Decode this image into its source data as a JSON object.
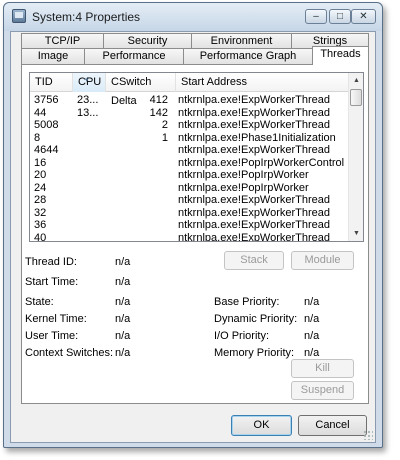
{
  "window": {
    "title": "System:4 Properties"
  },
  "title_buttons": {
    "minimize": "–",
    "maximize": "□",
    "close": "✕"
  },
  "tabs": {
    "row1": [
      "TCP/IP",
      "Security",
      "Environment",
      "Strings"
    ],
    "row2": [
      "Image",
      "Performance",
      "Performance Graph",
      "Threads"
    ],
    "active": "Threads"
  },
  "threads_list": {
    "columns": [
      "TID",
      "CPU",
      "CSwitch Delta",
      "Start Address"
    ],
    "sorted_column": "CPU",
    "rows": [
      [
        "3756",
        "23...",
        "412",
        "ntkrnlpa.exe!ExpWorkerThread"
      ],
      [
        "44",
        "13...",
        "142",
        "ntkrnlpa.exe!ExpWorkerThread"
      ],
      [
        "5008",
        "",
        "2",
        "ntkrnlpa.exe!ExpWorkerThread"
      ],
      [
        "8",
        "",
        "1",
        "ntkrnlpa.exe!Phase1Initialization"
      ],
      [
        "4644",
        "",
        "",
        "ntkrnlpa.exe!ExpWorkerThread"
      ],
      [
        "16",
        "",
        "",
        "ntkrnlpa.exe!PopIrpWorkerControl"
      ],
      [
        "20",
        "",
        "",
        "ntkrnlpa.exe!PopIrpWorker"
      ],
      [
        "24",
        "",
        "",
        "ntkrnlpa.exe!PopIrpWorker"
      ],
      [
        "28",
        "",
        "",
        "ntkrnlpa.exe!ExpWorkerThread"
      ],
      [
        "32",
        "",
        "",
        "ntkrnlpa.exe!ExpWorkerThread"
      ],
      [
        "36",
        "",
        "",
        "ntkrnlpa.exe!ExpWorkerThread"
      ],
      [
        "40",
        "",
        "",
        "ntkrnlpa.exe!ExpWorkerThread"
      ]
    ]
  },
  "buttons": {
    "stack": "Stack",
    "module": "Module",
    "kill": "Kill",
    "suspend": "Suspend"
  },
  "details_left": [
    {
      "label": "Thread ID:",
      "value": "n/a"
    },
    {
      "label": "Start Time:",
      "value": "n/a"
    },
    {
      "label": "State:",
      "value": "n/a"
    },
    {
      "label": "Kernel Time:",
      "value": "n/a"
    },
    {
      "label": "User Time:",
      "value": "n/a"
    },
    {
      "label": "Context Switches:",
      "value": "n/a"
    }
  ],
  "details_right": [
    {
      "label": "Base Priority:",
      "value": "n/a"
    },
    {
      "label": "Dynamic Priority:",
      "value": "n/a"
    },
    {
      "label": "I/O Priority:",
      "value": "n/a"
    },
    {
      "label": "Memory Priority:",
      "value": "n/a"
    }
  ],
  "dialog_buttons": {
    "ok": "OK",
    "cancel": "Cancel"
  }
}
